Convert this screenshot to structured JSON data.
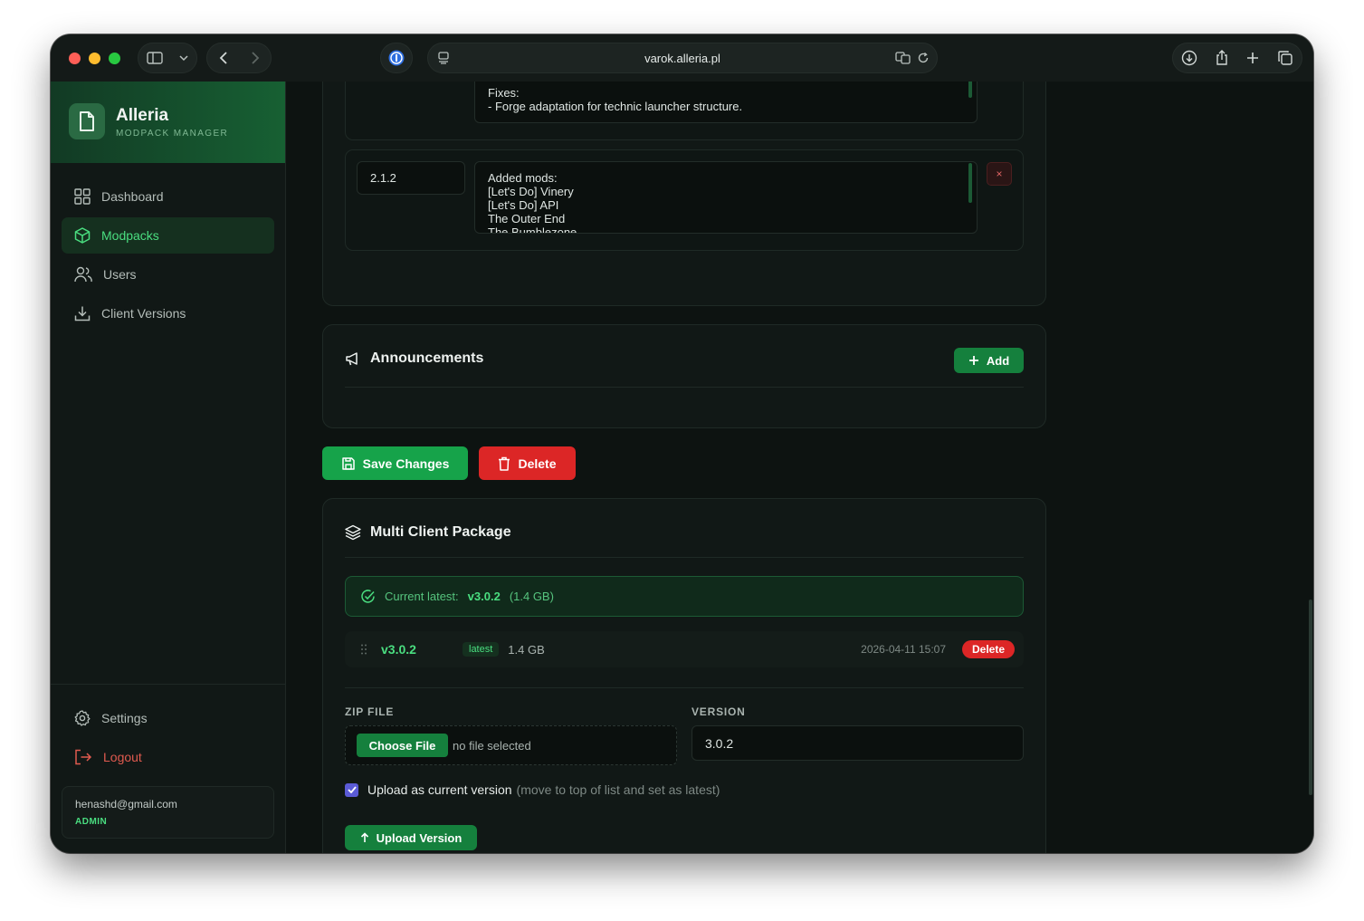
{
  "browser": {
    "url": "varok.alleria.pl"
  },
  "sidebar": {
    "brand_title": "Alleria",
    "brand_subtitle": "MODPACK MANAGER",
    "nav": [
      {
        "label": "Dashboard",
        "icon": "grid-icon",
        "active": false
      },
      {
        "label": "Modpacks",
        "icon": "package-icon",
        "active": true
      },
      {
        "label": "Users",
        "icon": "users-icon",
        "active": false
      },
      {
        "label": "Client Versions",
        "icon": "download-icon",
        "active": false
      }
    ],
    "settings_label": "Settings",
    "logout_label": "Logout",
    "user_email": "henashd@gmail.com",
    "user_role": "ADMIN"
  },
  "changelog": {
    "prev_notes": "Fixes:\n- Forge adaptation for technic launcher structure.",
    "entry_version": "2.1.2",
    "entry_notes": "Added mods:\n[Let's Do] Vinery\n[Let's Do] API\nThe Outer End\nThe Bumblezone",
    "remove_label": "×"
  },
  "announcements": {
    "title": "Announcements",
    "add_label": "Add"
  },
  "actions": {
    "save_label": "Save Changes",
    "delete_label": "Delete"
  },
  "multi_client": {
    "title": "Multi Client Package",
    "current_latest_label": "Current latest:",
    "current_latest_version": "v3.0.2",
    "current_latest_size": "(1.4 GB)",
    "versions": [
      {
        "version": "v3.0.2",
        "badge": "latest",
        "size": "1.4 GB",
        "date": "2026-04-11 15:07",
        "delete_label": "Delete"
      }
    ],
    "zip_label": "ZIP FILE",
    "choose_file_label": "Choose File",
    "no_file_label": "no file selected",
    "version_label": "VERSION",
    "version_value": "3.0.2",
    "upload_current_label": "Upload as current version",
    "upload_current_hint": "(move to top of list and set as latest)",
    "upload_current_checked": true,
    "upload_label": "Upload Version"
  },
  "colors": {
    "accent": "#16a34a",
    "accent_text": "#4ade80",
    "danger": "#dc2626",
    "background": "#0d1311"
  }
}
